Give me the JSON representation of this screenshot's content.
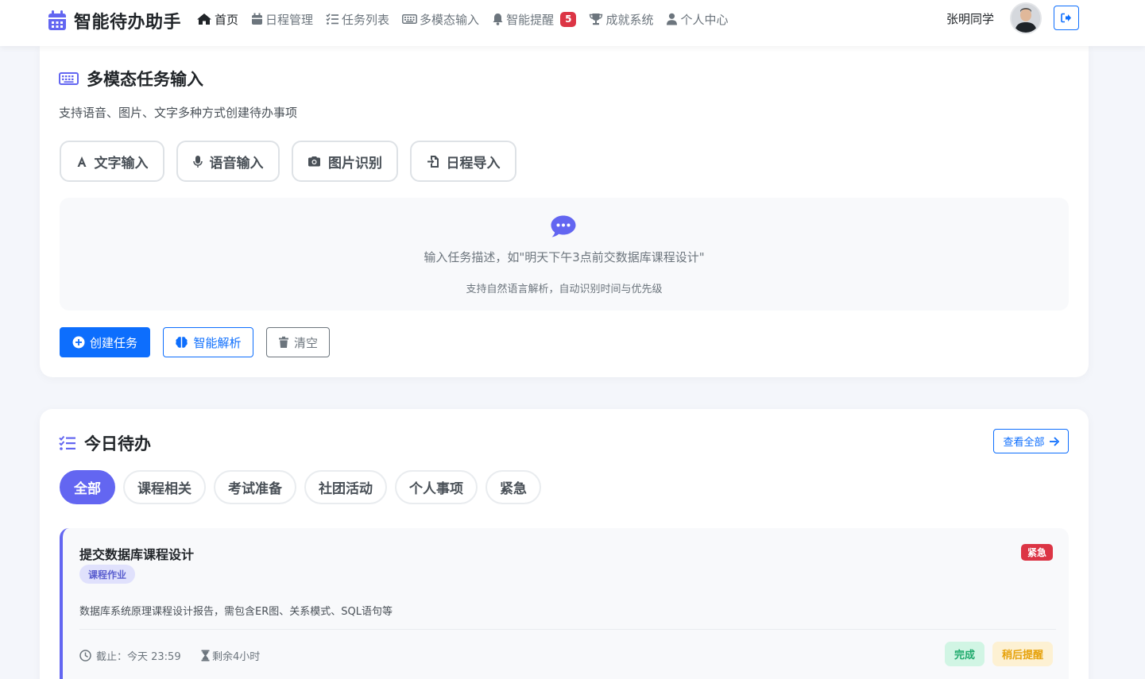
{
  "app": {
    "title": "智能待办助手"
  },
  "nav": {
    "items": [
      {
        "label": "首页",
        "icon": "home-icon",
        "active": true
      },
      {
        "label": "日程管理",
        "icon": "calendar-icon"
      },
      {
        "label": "任务列表",
        "icon": "list-check-icon"
      },
      {
        "label": "多模态输入",
        "icon": "keyboard-icon"
      },
      {
        "label": "智能提醒",
        "icon": "bell-icon",
        "badge": "5"
      },
      {
        "label": "成就系统",
        "icon": "trophy-icon"
      },
      {
        "label": "个人中心",
        "icon": "user-icon"
      }
    ]
  },
  "user": {
    "name": "张明同学"
  },
  "multimodal": {
    "title": "多模态任务输入",
    "subtitle": "支持语音、图片、文字多种方式创建待办事项",
    "modes": [
      "文字输入",
      "语音输入",
      "图片识别",
      "日程导入"
    ],
    "hint": "输入任务描述，如\"明天下午3点前交数据库课程设计\"",
    "sub_hint": "支持自然语言解析，自动识别时间与优先级",
    "actions": {
      "create": "创建任务",
      "parse": "智能解析",
      "clear": "清空"
    }
  },
  "today": {
    "title": "今日待办",
    "view_all": "查看全部",
    "filters": [
      "全部",
      "课程相关",
      "考试准备",
      "社团活动",
      "个人事项",
      "紧急"
    ],
    "active_filter": "全部",
    "task": {
      "title": "提交数据库课程设计",
      "tag": "课程作业",
      "priority": "紧急",
      "description": "数据库系统原理课程设计报告，需包含ER图、关系模式、SQL语句等",
      "deadline": "截止：今天 23:59",
      "remaining": "剩余4小时",
      "done_label": "完成",
      "later_label": "稍后提醒"
    }
  },
  "colors": {
    "primary": "#0d6efd",
    "accent": "#6366f1",
    "danger": "#dc3545",
    "success": "#1faa6c",
    "warning": "#e6a20b"
  }
}
